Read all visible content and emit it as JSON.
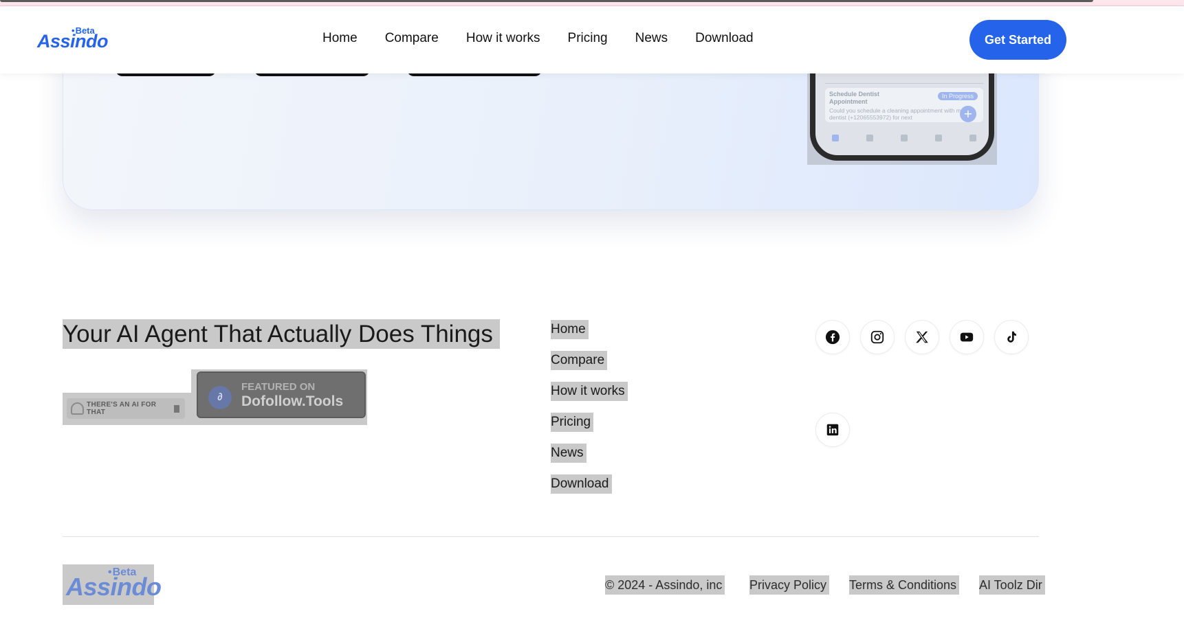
{
  "header": {
    "logo_text": "Assindo",
    "logo_badge": "Beta",
    "nav": [
      "Home",
      "Compare",
      "How it works",
      "Pricing",
      "News",
      "Download"
    ],
    "cta_label": "Get Started"
  },
  "hero": {
    "phone_task_title": "Schedule Dentist Appointment",
    "phone_task_body": "Could you schedule a cleaning appointment with my dentist (+12065553972) for next",
    "phone_task_status": "In Progress"
  },
  "footer": {
    "tagline": "Your AI Agent That Actually Does Things",
    "badges": {
      "ai_label": "THERE'S AN AI FOR THAT",
      "dt_small": "FEATURED ON",
      "dt_big": "Dofollow.Tools"
    },
    "links": [
      "Home",
      "Compare",
      "How it works",
      "Pricing",
      "News",
      "Download"
    ],
    "socials": [
      "facebook-icon",
      "instagram-icon",
      "x-icon",
      "youtube-icon",
      "tiktok-icon",
      "linkedin-icon"
    ],
    "logo_text": "Assindo",
    "logo_badge": "Beta",
    "copyright": "© 2024 - Assindo, inc",
    "privacy": "Privacy Policy",
    "terms": "Terms & Conditions",
    "directory": "AI Toolz Dir"
  },
  "colors": {
    "brand": "#2563eb",
    "highlight": "#c9c9c9",
    "top_strip": "#fde6ec"
  }
}
